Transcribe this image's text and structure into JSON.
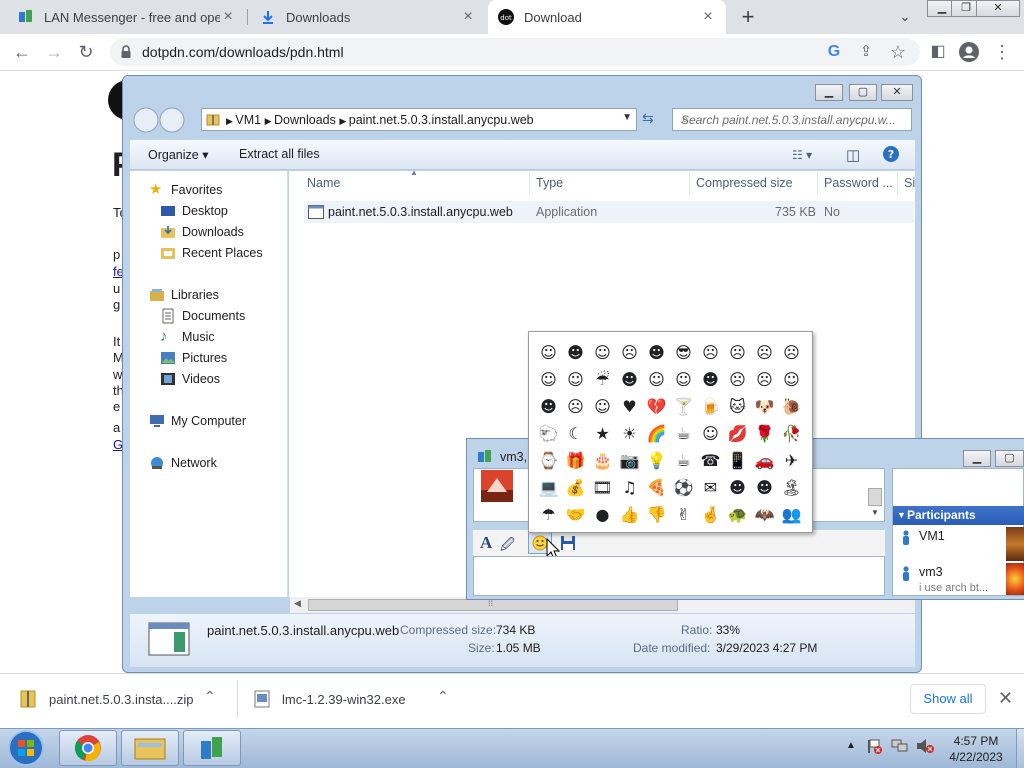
{
  "browser": {
    "tabs": [
      {
        "title": "LAN Messenger - free and open",
        "active": false
      },
      {
        "title": "Downloads",
        "active": false
      },
      {
        "title": "Download",
        "active": true
      }
    ],
    "url": "dotpdn.com/downloads/pdn.html"
  },
  "page_fragments": {
    "heading_letter": "P",
    "lines": [
      "To",
      "p",
      "fe",
      "u",
      "g",
      "It",
      "M",
      "w",
      "th",
      "e",
      "a",
      "G"
    ]
  },
  "explorer": {
    "breadcrumb": [
      "VM1",
      "Downloads",
      "paint.net.5.0.3.install.anycpu.web"
    ],
    "search_placeholder": "Search paint.net.5.0.3.install.anycpu.w...",
    "commands": {
      "organize": "Organize",
      "extract_all": "Extract all files"
    },
    "nav": {
      "favorites": "Favorites",
      "favorite_items": [
        "Desktop",
        "Downloads",
        "Recent Places"
      ],
      "libraries": "Libraries",
      "library_items": [
        "Documents",
        "Music",
        "Pictures",
        "Videos"
      ],
      "computer": "My Computer",
      "network": "Network"
    },
    "columns": [
      "Name",
      "Type",
      "Compressed size",
      "Password ...",
      "Si"
    ],
    "files": [
      {
        "name": "paint.net.5.0.3.install.anycpu.web",
        "type": "Application",
        "compressed_size": "735 KB",
        "password": "No"
      }
    ],
    "details": {
      "filename": "paint.net.5.0.3.install.anycpu.web",
      "compressed_size_label": "Compressed size:",
      "compressed_size": "734 KB",
      "size_label": "Size:",
      "size": "1.05 MB",
      "ratio_label": "Ratio:",
      "ratio": "33%",
      "date_label": "Date modified:",
      "date": "3/29/2023 4:27 PM"
    }
  },
  "messenger": {
    "title": "vm3, V",
    "participants_header": "Participants",
    "participants": [
      {
        "name": "VM1",
        "status": ""
      },
      {
        "name": "vm3",
        "status": "i use arch bt..."
      }
    ],
    "emoticons": [
      "☺",
      "☻",
      "☺",
      "☹",
      "☻",
      "😎",
      "☹",
      "☹",
      "☹",
      "☹",
      "☺",
      "☺",
      "☔",
      "☻",
      "☺",
      "☺",
      "☻",
      "☹",
      "☹",
      "☺",
      "☻",
      "☹",
      "☺",
      "♥",
      "💔",
      "🍸",
      "🍺",
      "🐱",
      "🐶",
      "🐌",
      "🐑",
      "☾",
      "★",
      "☀",
      "🌈",
      "☕",
      "☺",
      "💋",
      "🌹",
      "🥀",
      "⌚",
      "🎁",
      "🎂",
      "📷",
      "💡",
      "☕",
      "☎",
      "📱",
      "🚗",
      "✈",
      "💻",
      "💰",
      "🎞",
      "♫",
      "🍕",
      "⚽",
      "✉",
      "☻",
      "☻",
      "🏝",
      "☂",
      "🤝",
      "●",
      "👍",
      "👎",
      "✌",
      "🤞",
      "🐢",
      "🦇",
      "👥"
    ]
  },
  "downloads": {
    "items": [
      {
        "name": "paint.net.5.0.3.insta....zip"
      },
      {
        "name": "lmc-1.2.39-win32.exe"
      }
    ],
    "show_all": "Show all"
  },
  "taskbar": {
    "time": "4:57 PM",
    "date": "4/22/2023"
  }
}
